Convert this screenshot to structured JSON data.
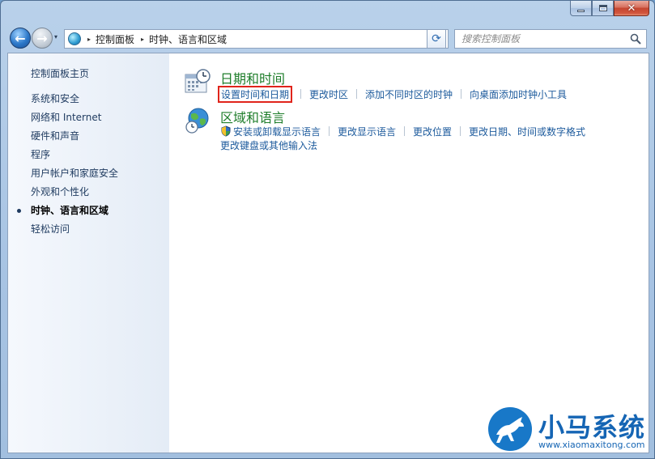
{
  "window": {
    "caption": {
      "close_glyph": "✕"
    }
  },
  "nav": {
    "back_glyph": "←",
    "forward_glyph": "→",
    "recent_glyph": "▾",
    "address": {
      "separator": "▸",
      "crumbs": [
        "控制面板",
        "时钟、语言和区域"
      ],
      "dropdown_glyph": "▾"
    },
    "refresh_glyph": "⟳",
    "search": {
      "placeholder": "搜索控制面板"
    }
  },
  "sidebar": {
    "home_label": "控制面板主页",
    "items": [
      {
        "label": "系统和安全"
      },
      {
        "label": "网络和 Internet"
      },
      {
        "label": "硬件和声音"
      },
      {
        "label": "程序"
      },
      {
        "label": "用户帐户和家庭安全"
      },
      {
        "label": "外观和个性化"
      },
      {
        "label": "时钟、语言和区域",
        "active": true
      },
      {
        "label": "轻松访问"
      }
    ]
  },
  "categories": {
    "datetime": {
      "title": "日期和时间",
      "links": [
        "设置时间和日期",
        "更改时区",
        "添加不同时区的时钟",
        "向桌面添加时钟小工具"
      ]
    },
    "region": {
      "title": "区域和语言",
      "links": [
        "安装或卸载显示语言",
        "更改显示语言",
        "更改位置",
        "更改日期、时间或数字格式",
        "更改键盘或其他输入法"
      ]
    }
  },
  "watermark": {
    "brand": "小马系统",
    "url": "www.xiaomaxitong.com"
  },
  "colors": {
    "link": "#1c5a9c",
    "category_title": "#1e7d2a",
    "highlight_border": "#e0241b",
    "sidebar_text": "#1e3a5f"
  }
}
